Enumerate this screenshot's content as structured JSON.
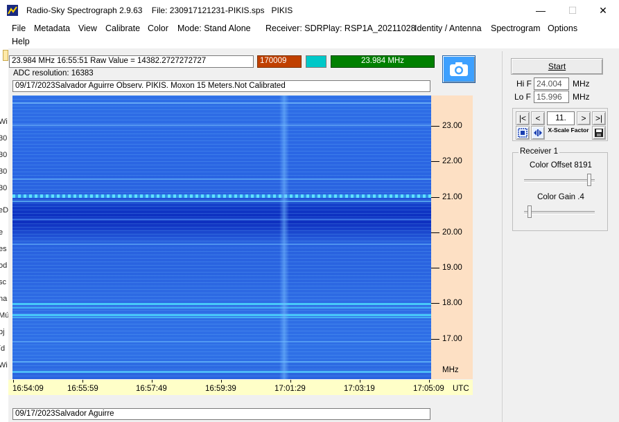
{
  "window": {
    "title": "Radio-Sky Spectrograph 2.9.63    File: 230917121231-PIKIS.sps   PIKIS",
    "minimize": "—",
    "maximize": "☐",
    "close": "✕"
  },
  "menu": {
    "file": "File",
    "metadata": "Metadata",
    "view": "View",
    "calibrate": "Calibrate",
    "color": "Color",
    "mode": "Mode: Stand Alone",
    "receiver": "Receiver:  SDRPlay: RSP1A_20211028",
    "identity": "Identity / Antenna",
    "spectrogram": "Spectrogram",
    "options": "Options",
    "help": "Help"
  },
  "left_strip": [
    "Wi",
    "30",
    "30",
    "30",
    "30",
    "eD",
    "e",
    "es",
    "od",
    "sc",
    "na",
    "Mú",
    "bj",
    "íd",
    "Wi"
  ],
  "readout": {
    "cursor": "23.984 MHz  16:55:51  Raw Value =  14382.2727272727",
    "value_box": "170009",
    "freq_box": "23.984 MHz",
    "adc": "ADC resolution:  16383",
    "header_text": "09/17/2023Salvador Aguirre Observ. PIKIS. Moxon 15 Meters.Not Calibrated",
    "footer_text": "09/17/2023Salvador Aguirre",
    "value_color": "#c04000",
    "swatch_color": "#00c8c8",
    "freq_color": "#008000"
  },
  "chart_data": {
    "type": "heatmap",
    "y_unit": "MHz",
    "x_unit": "UTC",
    "y_ticks": [
      "23.00",
      "22.00",
      "21.00",
      "20.00",
      "19.00",
      "18.00",
      "17.00"
    ],
    "x_ticks": [
      "16:54:09",
      "16:55:59",
      "16:57:49",
      "16:59:39",
      "17:01:29",
      "17:03:19",
      "17:05:09"
    ],
    "ylim": [
      15.996,
      24.004
    ],
    "xlim": [
      "16:54:09",
      "17:05:09"
    ]
  },
  "panel": {
    "start": "Start",
    "hif_label": "Hi F",
    "hif_value": "24.004",
    "lof_label": "Lo F",
    "lof_value": "15.996",
    "mhz": "MHz",
    "nav_first": "|<",
    "nav_prev": "<",
    "nav_value": "11.",
    "nav_next": ">",
    "nav_last": ">|",
    "xscale": "X-Scale Factor",
    "group_title": "Receiver 1",
    "offset_label": "Color Offset 8191",
    "gain_label": "Color Gain .4",
    "offset_level": 0.95,
    "gain_level": 0.05
  }
}
